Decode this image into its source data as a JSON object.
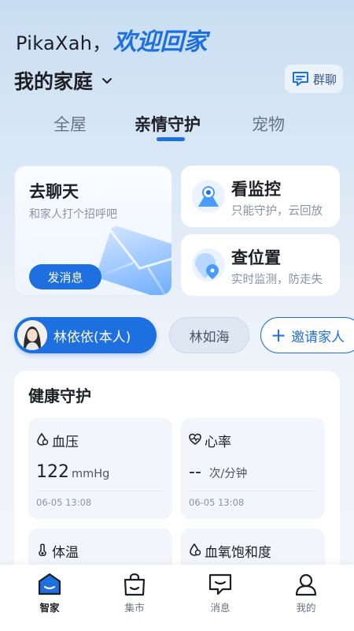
{
  "header": {
    "user_name": "PikaXah，",
    "welcome": "欢迎回家",
    "family_title": "我的家庭",
    "group_chat_label": "群聊"
  },
  "tabs": [
    {
      "label": "全屋",
      "active": false
    },
    {
      "label": "亲情守护",
      "active": true
    },
    {
      "label": "宠物",
      "active": false
    }
  ],
  "cards": {
    "chat": {
      "title": "去聊天",
      "subtitle": "和家人打个招呼吧",
      "button": "发消息"
    },
    "monitor": {
      "title": "看监控",
      "subtitle": "只能守护，云回放"
    },
    "location": {
      "title": "查位置",
      "subtitle": "实时监测，防走失"
    }
  },
  "members": {
    "me": "林依依(本人)",
    "other": "林如海",
    "invite": "邀请家人"
  },
  "health": {
    "title": "健康守护",
    "items": [
      {
        "label": "血压",
        "value": "122",
        "unit": "mmHg",
        "time": "06-05 13:08",
        "icon": "blood-pressure-icon"
      },
      {
        "label": "心率",
        "value": "--",
        "unit": "次/分钟",
        "time": "06-05 13:08",
        "icon": "heart-rate-icon"
      },
      {
        "label": "体温",
        "value": "",
        "unit": "",
        "time": "",
        "icon": "thermometer-icon"
      },
      {
        "label": "血氧饱和度",
        "value": "",
        "unit": "",
        "time": "",
        "icon": "blood-oxygen-icon"
      }
    ]
  },
  "bottom_nav": [
    {
      "label": "智家",
      "active": true,
      "icon": "home-icon"
    },
    {
      "label": "集市",
      "active": false,
      "icon": "shopping-bag-icon"
    },
    {
      "label": "消息",
      "active": false,
      "icon": "message-icon"
    },
    {
      "label": "我的",
      "active": false,
      "icon": "profile-icon"
    }
  ],
  "colors": {
    "accent": "#1e6fe0",
    "background_top": "#c9def3",
    "muted": "#8a93a3"
  }
}
